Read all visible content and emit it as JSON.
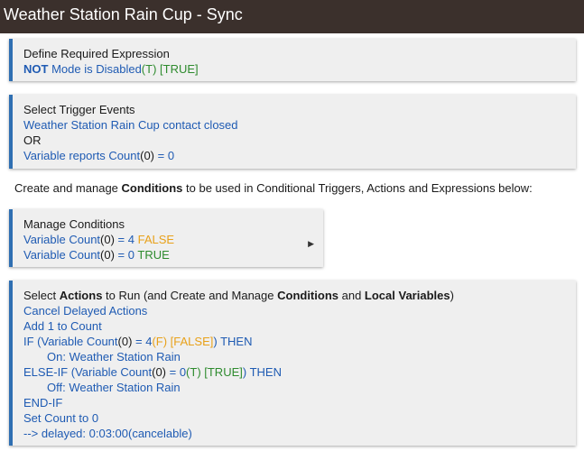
{
  "title": "Weather Station Rain Cup - Sync",
  "required_expression": {
    "heading": "Define Required Expression",
    "not": "NOT",
    "mode": "Mode is Disabled",
    "t": "(T)",
    "true": "[TRUE]"
  },
  "triggers": {
    "heading": "Select Trigger Events",
    "event1": "Weather Station Rain Cup contact closed",
    "or": "OR",
    "event2_a": "Variable reports Count",
    "event2_b": "(0)",
    "event2_c": " = 0"
  },
  "intro": {
    "before": "Create and manage ",
    "bold": "Conditions",
    "after": " to be used in Conditional Triggers, Actions and Expressions below:"
  },
  "conditions": {
    "heading": "Manage Conditions",
    "c1_a": "Variable Count",
    "c1_b": "(0)",
    "c1_c": " = 4 ",
    "c1_state": "FALSE",
    "c2_a": "Variable Count",
    "c2_b": "(0)",
    "c2_c": " = 0 ",
    "c2_state": "TRUE",
    "arrow_icon": "▶"
  },
  "actions": {
    "h_select": "Select ",
    "h_actions": "Actions",
    "h_mid": " to Run (and Create and Manage ",
    "h_conditions": "Conditions",
    "h_and": " and ",
    "h_local": "Local Variables",
    "h_end": ")",
    "cancel": "Cancel Delayed Actions",
    "add": "Add 1 to Count",
    "if_a": "IF (Variable Count",
    "if_b": "(0)",
    "if_c": " = 4",
    "if_f": "(F) [FALSE]",
    "if_d": ") THEN",
    "on": "On: Weather Station Rain",
    "elseif_a": "ELSE-IF (Variable Count",
    "elseif_b": "(0)",
    "elseif_c": " = 0",
    "elseif_t": "(T) [TRUE]",
    "elseif_d": ") THEN",
    "off": "Off: Weather Station Rain",
    "endif": "END-IF",
    "set": "Set Count to 0",
    "delayed": " --> delayed: 0:03:00(cancelable)"
  },
  "colors": {
    "title_bar": "#3b302c",
    "accent": "#2f6fb2",
    "blue_text": "#1f5bb3",
    "green": "#2e8b2e",
    "orange": "#e8a11a"
  }
}
